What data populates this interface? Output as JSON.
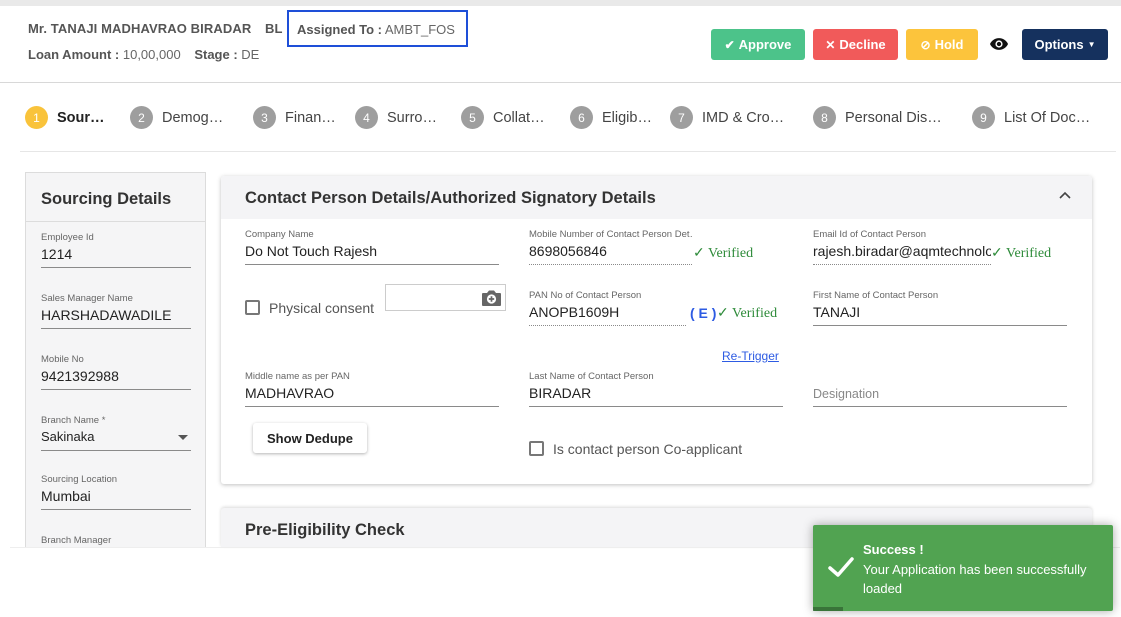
{
  "header": {
    "applicant_name": "Mr. TANAJI MADHAVRAO BIRADAR",
    "product": "BL",
    "assigned_label": "Assigned To :",
    "assigned_value": "AMBT_FOS",
    "loan_amount_label": "Loan Amount :",
    "loan_amount_value": "10,00,000",
    "stage_label": "Stage :",
    "stage_value": "DE",
    "buttons": {
      "approve": "Approve",
      "decline": "Decline",
      "hold": "Hold",
      "options": "Options"
    }
  },
  "steps": [
    {
      "num": "1",
      "label": "Sour…"
    },
    {
      "num": "2",
      "label": "Demog…"
    },
    {
      "num": "3",
      "label": "Finan…"
    },
    {
      "num": "4",
      "label": "Surro…"
    },
    {
      "num": "5",
      "label": "Collat…"
    },
    {
      "num": "6",
      "label": "Eligib…"
    },
    {
      "num": "7",
      "label": "IMD & Cro…"
    },
    {
      "num": "8",
      "label": "Personal Dis…"
    },
    {
      "num": "9",
      "label": "List Of Doc…"
    }
  ],
  "sourcing": {
    "title": "Sourcing Details",
    "fields": [
      {
        "label": "Employee Id",
        "value": "1214"
      },
      {
        "label": "Sales Manager Name",
        "value": "HARSHADAWADILE"
      },
      {
        "label": "Mobile No",
        "value": "9421392988"
      },
      {
        "label": "Branch Name *",
        "value": "Sakinaka"
      },
      {
        "label": "Sourcing Location",
        "value": "Mumbai"
      },
      {
        "label": "Branch Manager",
        "value": ""
      }
    ]
  },
  "contact": {
    "title": "Contact Person Details/Authorized Signatory Details",
    "company_name_label": "Company Name",
    "company_name": "Do Not Touch Rajesh",
    "mobile_label": "Mobile Number of Contact Person Det…",
    "mobile": "8698056846",
    "email_label": "Email Id of Contact Person",
    "email": "rajesh.biradar@aqmtechnolo",
    "verified_text": "Verified",
    "physical_consent_label": "Physical consent",
    "pan_label": "PAN No of Contact Person",
    "pan": "ANOPB1609H",
    "pan_tag": "( E )",
    "retrigger": "Re-Trigger",
    "first_name_label": "First Name of Contact Person",
    "first_name": "TANAJI",
    "middle_name_label": "Middle name as per PAN",
    "middle_name": "MADHAVRAO",
    "last_name_label": "Last Name of Contact Person",
    "last_name": "BIRADAR",
    "designation_placeholder": "Designation",
    "show_dedupe": "Show Dedupe",
    "coapplicant_label": "Is contact person Co-applicant"
  },
  "pre_eligibility": {
    "title": "Pre-Eligibility Check"
  },
  "toast": {
    "title": "Success !",
    "message": "Your Application has been successfully loaded",
    "progress": 0.1
  },
  "colors": {
    "approve": "#4cc38a",
    "decline": "#f15a5a",
    "hold": "#fcc43c",
    "options": "#15315e",
    "active_step": "#f9c33b",
    "verified": "#2e8b3a",
    "toast": "#51a351"
  }
}
